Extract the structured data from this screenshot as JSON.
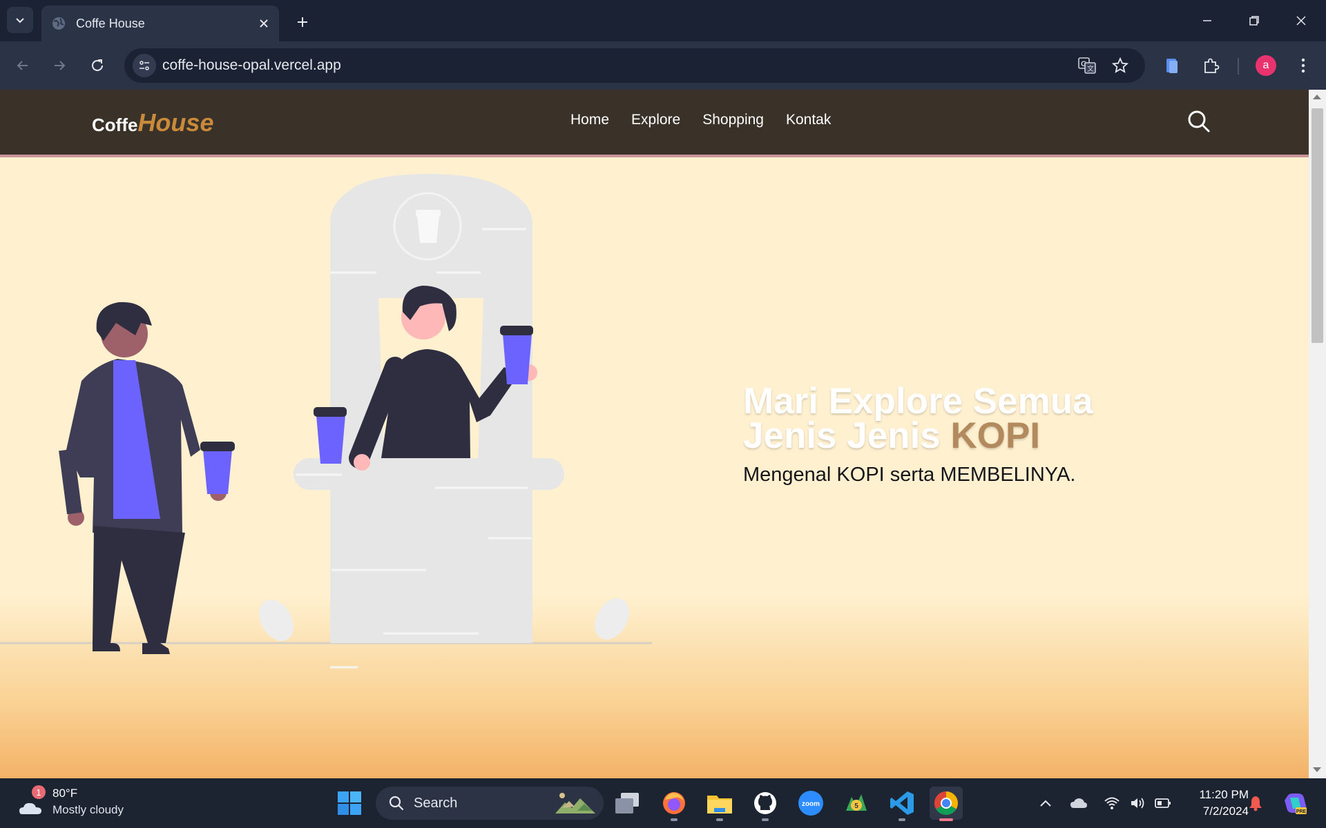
{
  "browser": {
    "tab_title": "Coffe House",
    "url": "coffe-house-opal.vercel.app",
    "profile_initial": "a"
  },
  "site": {
    "logo_part1": "Coffe",
    "logo_part2": "House",
    "nav_items": [
      "Home",
      "Explore",
      "Shopping",
      "Kontak"
    ],
    "hero_title_line1": "Mari Explore Semua",
    "hero_title_line2_prefix": "Jenis Jenis ",
    "hero_title_accent": "KOPI",
    "hero_subtitle": "Mengenal KOPI serta MEMBELINYA.",
    "colors": {
      "nav_bg": "#3a3229",
      "hero_bg": "#fff1d0",
      "accent": "#b38a5e",
      "logo_accent": "#c98a3c",
      "figure_purple": "#6c63ff",
      "figure_dark": "#2f2e41"
    }
  },
  "taskbar": {
    "weather_temp": "80°F",
    "weather_condition": "Mostly cloudy",
    "weather_badge": "1",
    "search_label": "Search",
    "time": "11:20 PM",
    "date": "7/2/2024",
    "apps": [
      "start-icon",
      "task-view-icon",
      "firefox-icon",
      "file-explorer-icon",
      "github-icon",
      "zoom-icon",
      "metatrader-icon",
      "vscode-icon",
      "chrome-icon"
    ],
    "zoom_label": "zoom"
  }
}
